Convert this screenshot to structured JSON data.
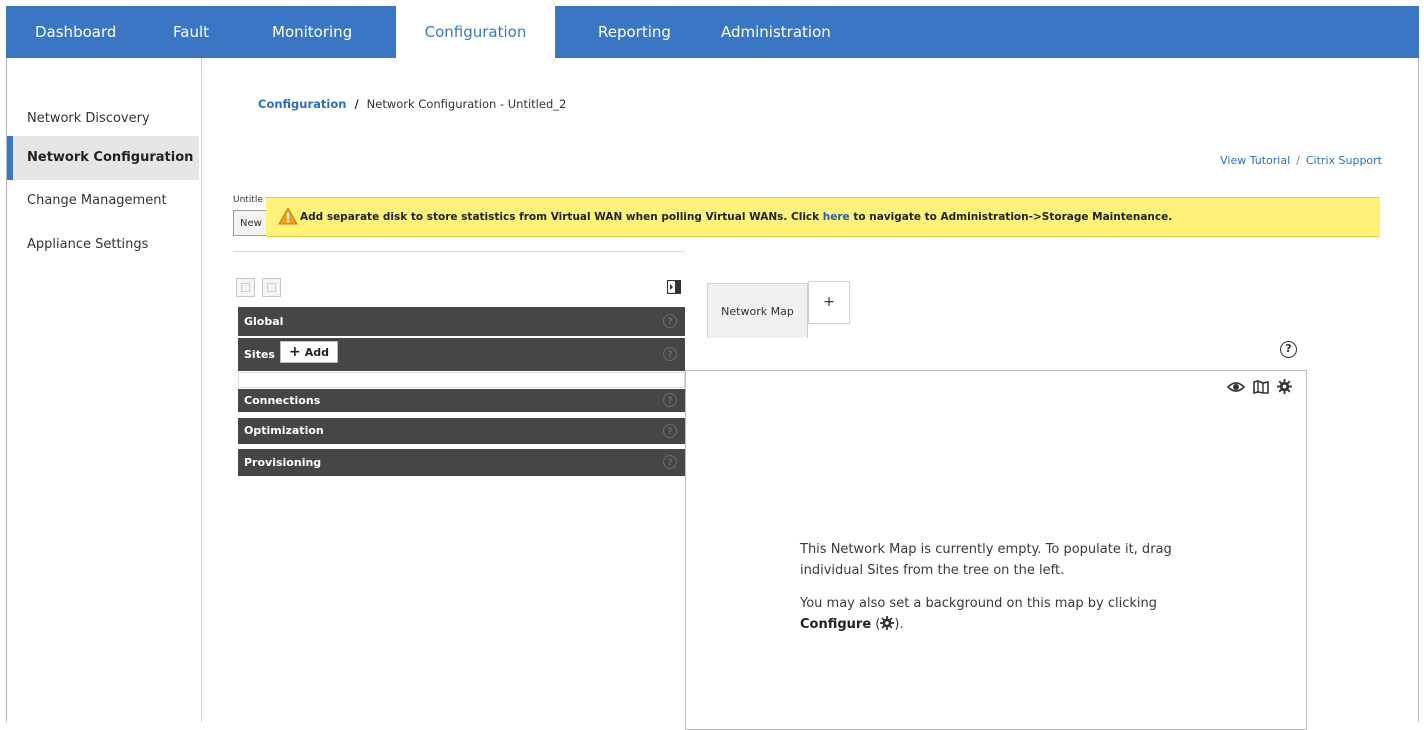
{
  "topnav": {
    "tabs": [
      {
        "label": "Dashboard"
      },
      {
        "label": "Fault"
      },
      {
        "label": "Monitoring"
      },
      {
        "label": "Configuration",
        "active": true
      },
      {
        "label": "Reporting"
      },
      {
        "label": "Administration"
      }
    ]
  },
  "sidebar": {
    "items": [
      {
        "label": "Network Discovery"
      },
      {
        "label": "Network Configuration",
        "active": true
      },
      {
        "label": "Change Management"
      },
      {
        "label": "Appliance Settings"
      }
    ]
  },
  "breadcrumb": {
    "root": "Configuration",
    "separator": "/",
    "current": "Network Configuration - Untitled_2"
  },
  "help_links": {
    "tutorial": "View Tutorial",
    "separator": "/",
    "support": "Citrix Support"
  },
  "config": {
    "name": "Untitle",
    "new_button": "New"
  },
  "banner": {
    "text_before": "Add separate disk to store statistics from Virtual WAN when polling Virtual WANs. Click ",
    "link": "here",
    "text_after": " to navigate to Administration->Storage Maintenance."
  },
  "tree": {
    "sections": {
      "global": "Global",
      "sites": "Sites",
      "connections": "Connections",
      "optimization": "Optimization",
      "provisioning": "Provisioning"
    },
    "add_button": "Add",
    "help_glyph": "?"
  },
  "map": {
    "tab_label": "Network Map",
    "add_tab": "+",
    "help_glyph": "?",
    "empty_line1": "This Network Map is currently empty. To populate it, drag individual Sites from the tree on the left.",
    "empty_line2": "You may also set a background on this map by clicking",
    "configure_label": "Configure",
    "configure_open": " (",
    "configure_close": ")."
  },
  "colors": {
    "nav_blue": "#3a76c4",
    "banner_yellow": "#fff27a",
    "section_dark": "#464646",
    "link_blue": "#2d6eb8"
  }
}
